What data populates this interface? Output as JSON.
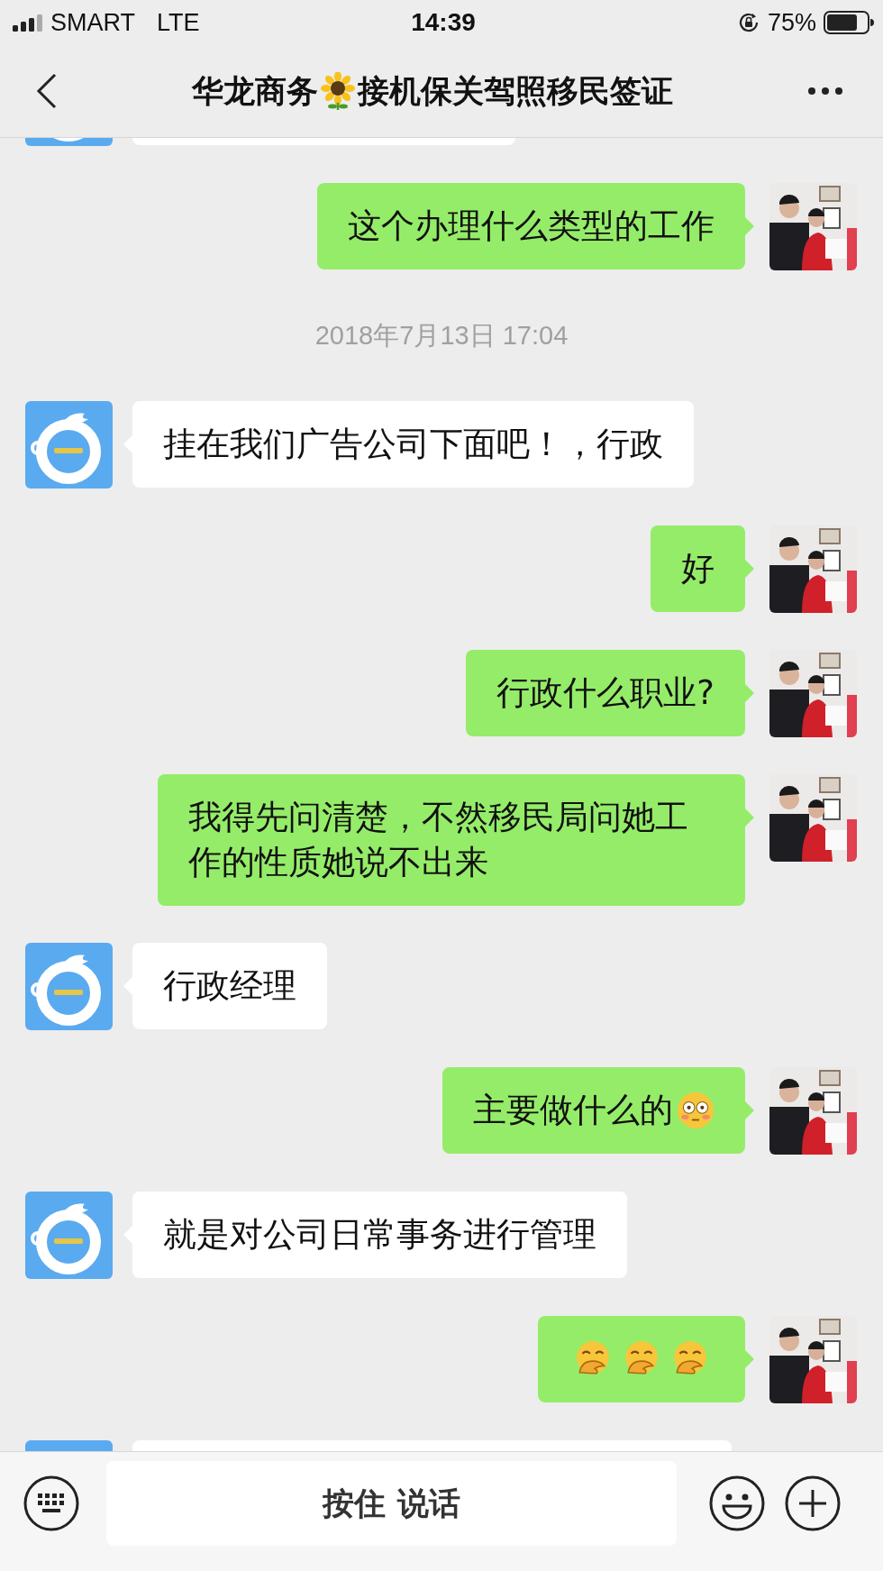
{
  "status_bar": {
    "carrier": "SMART",
    "network": "LTE",
    "time": "14:39",
    "battery": "75%"
  },
  "title": [
    {
      "kind": "text",
      "text": "华龙商务"
    },
    {
      "kind": "sunflower"
    },
    {
      "kind": "text",
      "text": "接机保关驾照移民签证"
    }
  ],
  "messages": [
    {
      "kind": "cut",
      "outgoing": false
    },
    {
      "kind": "message",
      "outgoing": true,
      "parts": [
        {
          "kind": "text",
          "text": "这个办理什么类型的工作"
        }
      ]
    },
    {
      "kind": "timestamp",
      "text": "2018年7月13日 17:04"
    },
    {
      "kind": "message",
      "outgoing": false,
      "parts": [
        {
          "kind": "text",
          "text": "挂在我们广告公司下面吧！，行政"
        }
      ]
    },
    {
      "kind": "message",
      "outgoing": true,
      "parts": [
        {
          "kind": "text",
          "text": "好"
        }
      ]
    },
    {
      "kind": "message",
      "outgoing": true,
      "parts": [
        {
          "kind": "text",
          "text": "行政什么职业?"
        }
      ]
    },
    {
      "kind": "message",
      "outgoing": true,
      "parts": [
        {
          "kind": "text",
          "text": "我得先问清楚，不然移民局问她工作的性质她说不出来"
        }
      ]
    },
    {
      "kind": "message",
      "outgoing": false,
      "parts": [
        {
          "kind": "text",
          "text": "行政经理"
        }
      ]
    },
    {
      "kind": "message",
      "outgoing": true,
      "parts": [
        {
          "kind": "text",
          "text": "主要做什么的"
        },
        {
          "kind": "flushed"
        }
      ]
    },
    {
      "kind": "message",
      "outgoing": false,
      "parts": [
        {
          "kind": "text",
          "text": "就是对公司日常事务进行管理"
        }
      ]
    },
    {
      "kind": "message",
      "outgoing": true,
      "parts": [
        {
          "kind": "covering-mouth"
        },
        {
          "kind": "covering-mouth"
        },
        {
          "kind": "covering-mouth"
        }
      ]
    },
    {
      "kind": "cut",
      "outgoing": false
    }
  ],
  "input_bar": {
    "hold_to_talk": "按住 说话"
  }
}
